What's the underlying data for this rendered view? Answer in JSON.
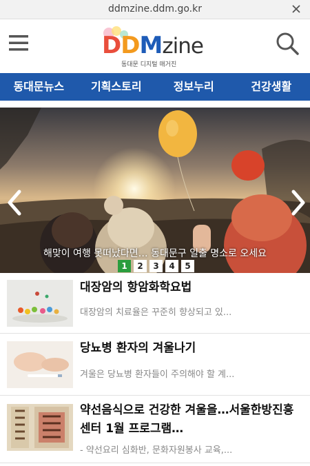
{
  "browser": {
    "url": "ddmzine.ddm.go.kr",
    "close_icon": "close-icon"
  },
  "header": {
    "menu_icon": "hamburger-menu-icon",
    "logo": {
      "d1": "D",
      "d2": "D",
      "m": "M",
      "zine": "zine",
      "subtitle": "동대문 디지털 매거진"
    },
    "search_icon": "search-icon"
  },
  "nav": {
    "tabs": [
      {
        "label": "동대문뉴스"
      },
      {
        "label": "기획스토리"
      },
      {
        "label": "정보누리"
      },
      {
        "label": "건강생활"
      }
    ]
  },
  "slider": {
    "caption": "해맞이 여행 못떠났다면… 동대문구 일출 명소로 오세요",
    "pages": [
      "1",
      "2",
      "3",
      "4",
      "5"
    ],
    "active_page": 1,
    "prev_icon": "chevron-left-icon",
    "next_icon": "chevron-right-icon"
  },
  "articles": [
    {
      "title": "대장암의 항암화학요법",
      "desc": "대장암의 치료율은 꾸준히 향상되고 있..."
    },
    {
      "title": "당뇨병 환자의 겨울나기",
      "desc": "겨울은 당뇨병 환자들이 주의해야 할 계..."
    },
    {
      "title": "약선음식으로 건강한 겨울을…서울한방진흥센터 1월 프로그램…",
      "desc": "- 약선요리 심화반, 문화자원봉사 교육,..."
    }
  ],
  "colors": {
    "nav_bg": "#1f59ab",
    "active_page": "#2a9d3e"
  }
}
